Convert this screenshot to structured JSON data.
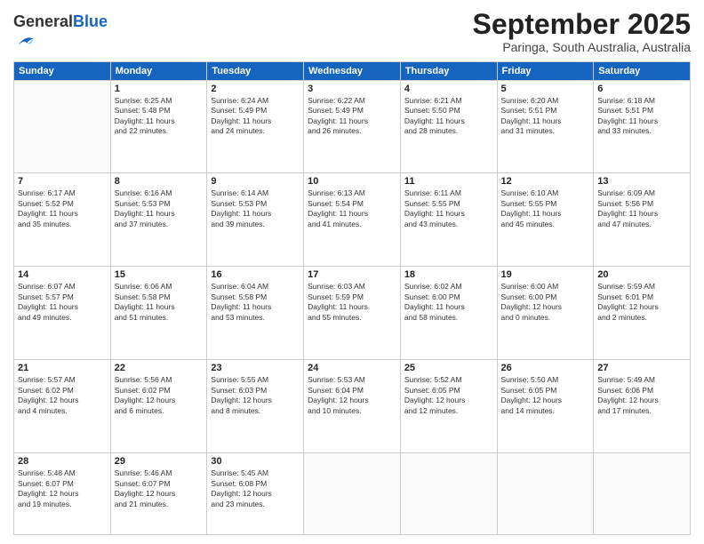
{
  "logo": {
    "general": "General",
    "blue": "Blue"
  },
  "header": {
    "month_title": "September 2025",
    "location": "Paringa, South Australia, Australia"
  },
  "days_of_week": [
    "Sunday",
    "Monday",
    "Tuesday",
    "Wednesday",
    "Thursday",
    "Friday",
    "Saturday"
  ],
  "weeks": [
    [
      {
        "day": null,
        "info": null
      },
      {
        "day": "1",
        "info": "Sunrise: 6:25 AM\nSunset: 5:48 PM\nDaylight: 11 hours\nand 22 minutes."
      },
      {
        "day": "2",
        "info": "Sunrise: 6:24 AM\nSunset: 5:49 PM\nDaylight: 11 hours\nand 24 minutes."
      },
      {
        "day": "3",
        "info": "Sunrise: 6:22 AM\nSunset: 5:49 PM\nDaylight: 11 hours\nand 26 minutes."
      },
      {
        "day": "4",
        "info": "Sunrise: 6:21 AM\nSunset: 5:50 PM\nDaylight: 11 hours\nand 28 minutes."
      },
      {
        "day": "5",
        "info": "Sunrise: 6:20 AM\nSunset: 5:51 PM\nDaylight: 11 hours\nand 31 minutes."
      },
      {
        "day": "6",
        "info": "Sunrise: 6:18 AM\nSunset: 5:51 PM\nDaylight: 11 hours\nand 33 minutes."
      }
    ],
    [
      {
        "day": "7",
        "info": "Sunrise: 6:17 AM\nSunset: 5:52 PM\nDaylight: 11 hours\nand 35 minutes."
      },
      {
        "day": "8",
        "info": "Sunrise: 6:16 AM\nSunset: 5:53 PM\nDaylight: 11 hours\nand 37 minutes."
      },
      {
        "day": "9",
        "info": "Sunrise: 6:14 AM\nSunset: 5:53 PM\nDaylight: 11 hours\nand 39 minutes."
      },
      {
        "day": "10",
        "info": "Sunrise: 6:13 AM\nSunset: 5:54 PM\nDaylight: 11 hours\nand 41 minutes."
      },
      {
        "day": "11",
        "info": "Sunrise: 6:11 AM\nSunset: 5:55 PM\nDaylight: 11 hours\nand 43 minutes."
      },
      {
        "day": "12",
        "info": "Sunrise: 6:10 AM\nSunset: 5:55 PM\nDaylight: 11 hours\nand 45 minutes."
      },
      {
        "day": "13",
        "info": "Sunrise: 6:09 AM\nSunset: 5:56 PM\nDaylight: 11 hours\nand 47 minutes."
      }
    ],
    [
      {
        "day": "14",
        "info": "Sunrise: 6:07 AM\nSunset: 5:57 PM\nDaylight: 11 hours\nand 49 minutes."
      },
      {
        "day": "15",
        "info": "Sunrise: 6:06 AM\nSunset: 5:58 PM\nDaylight: 11 hours\nand 51 minutes."
      },
      {
        "day": "16",
        "info": "Sunrise: 6:04 AM\nSunset: 5:58 PM\nDaylight: 11 hours\nand 53 minutes."
      },
      {
        "day": "17",
        "info": "Sunrise: 6:03 AM\nSunset: 5:59 PM\nDaylight: 11 hours\nand 55 minutes."
      },
      {
        "day": "18",
        "info": "Sunrise: 6:02 AM\nSunset: 6:00 PM\nDaylight: 11 hours\nand 58 minutes."
      },
      {
        "day": "19",
        "info": "Sunrise: 6:00 AM\nSunset: 6:00 PM\nDaylight: 12 hours\nand 0 minutes."
      },
      {
        "day": "20",
        "info": "Sunrise: 5:59 AM\nSunset: 6:01 PM\nDaylight: 12 hours\nand 2 minutes."
      }
    ],
    [
      {
        "day": "21",
        "info": "Sunrise: 5:57 AM\nSunset: 6:02 PM\nDaylight: 12 hours\nand 4 minutes."
      },
      {
        "day": "22",
        "info": "Sunrise: 5:56 AM\nSunset: 6:02 PM\nDaylight: 12 hours\nand 6 minutes."
      },
      {
        "day": "23",
        "info": "Sunrise: 5:55 AM\nSunset: 6:03 PM\nDaylight: 12 hours\nand 8 minutes."
      },
      {
        "day": "24",
        "info": "Sunrise: 5:53 AM\nSunset: 6:04 PM\nDaylight: 12 hours\nand 10 minutes."
      },
      {
        "day": "25",
        "info": "Sunrise: 5:52 AM\nSunset: 6:05 PM\nDaylight: 12 hours\nand 12 minutes."
      },
      {
        "day": "26",
        "info": "Sunrise: 5:50 AM\nSunset: 6:05 PM\nDaylight: 12 hours\nand 14 minutes."
      },
      {
        "day": "27",
        "info": "Sunrise: 5:49 AM\nSunset: 6:06 PM\nDaylight: 12 hours\nand 17 minutes."
      }
    ],
    [
      {
        "day": "28",
        "info": "Sunrise: 5:48 AM\nSunset: 6:07 PM\nDaylight: 12 hours\nand 19 minutes."
      },
      {
        "day": "29",
        "info": "Sunrise: 5:46 AM\nSunset: 6:07 PM\nDaylight: 12 hours\nand 21 minutes."
      },
      {
        "day": "30",
        "info": "Sunrise: 5:45 AM\nSunset: 6:08 PM\nDaylight: 12 hours\nand 23 minutes."
      },
      {
        "day": null,
        "info": null
      },
      {
        "day": null,
        "info": null
      },
      {
        "day": null,
        "info": null
      },
      {
        "day": null,
        "info": null
      }
    ]
  ]
}
